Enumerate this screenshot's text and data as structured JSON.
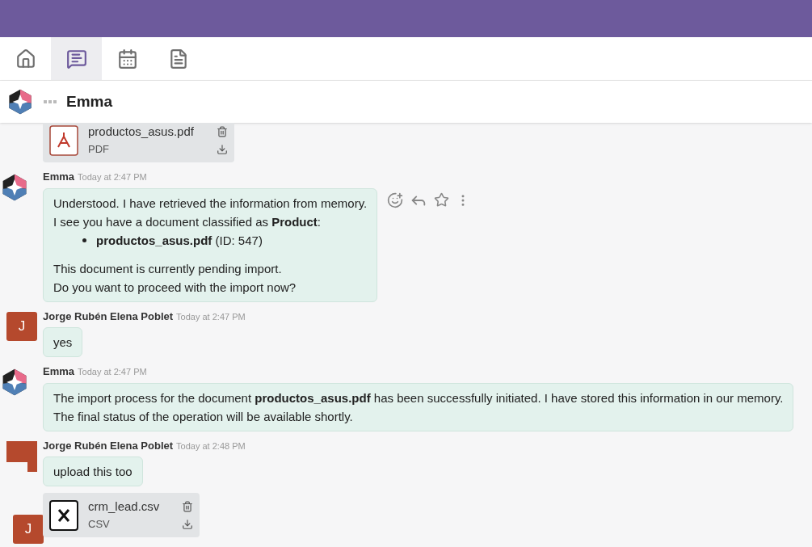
{
  "tabs": [
    {
      "selected": false
    },
    {
      "selected": true
    },
    {
      "selected": false
    },
    {
      "selected": false
    }
  ],
  "chat_header": {
    "title": "Emma"
  },
  "messages": [
    {
      "kind": "file",
      "file": {
        "kind": "pdf",
        "name": "productos_asus.pdf",
        "type": "PDF"
      }
    },
    {
      "kind": "message",
      "avatar": {
        "kind": "logo"
      },
      "author": "Emma",
      "time": "Today at 2:47 PM",
      "actions": true,
      "blocks": [
        {
          "kind": "text",
          "lines": [
            "Understood. I have retrieved the information from memory.",
            "I see you have a document classified as **Product**:"
          ]
        },
        {
          "kind": "list",
          "items": [
            "**productos_asus.pdf** (ID: 547)"
          ]
        },
        {
          "kind": "text",
          "lines": [
            "This document is currently pending import.",
            "Do you want to proceed with the import now?"
          ]
        }
      ]
    },
    {
      "kind": "message",
      "avatar": {
        "kind": "initial",
        "letter": "J"
      },
      "author": "Jorge Rubén Elena Poblet",
      "time": "Today at 2:47 PM",
      "actions": false,
      "blocks": [
        {
          "kind": "text",
          "lines": [
            "yes"
          ]
        }
      ]
    },
    {
      "kind": "message",
      "avatar": {
        "kind": "logo"
      },
      "author": "Emma",
      "time": "Today at 2:47 PM",
      "actions": false,
      "blocks": [
        {
          "kind": "text",
          "lines": [
            "The import process for the document **productos_asus.pdf** has been successfully initiated. I have stored this information in our memory.",
            "The final status of the operation will be available shortly."
          ]
        }
      ]
    },
    {
      "kind": "message",
      "avatar": {
        "kind": "blank"
      },
      "author": "Jorge Rubén Elena Poblet",
      "time": "Today at 2:48 PM",
      "actions": false,
      "blocks": [
        {
          "kind": "text",
          "lines": [
            "upload this too"
          ]
        }
      ]
    },
    {
      "kind": "file",
      "avatar_letter": "J",
      "file": {
        "kind": "spreadsheet",
        "name": "crm_lead.csv",
        "type": "CSV"
      }
    }
  ]
}
